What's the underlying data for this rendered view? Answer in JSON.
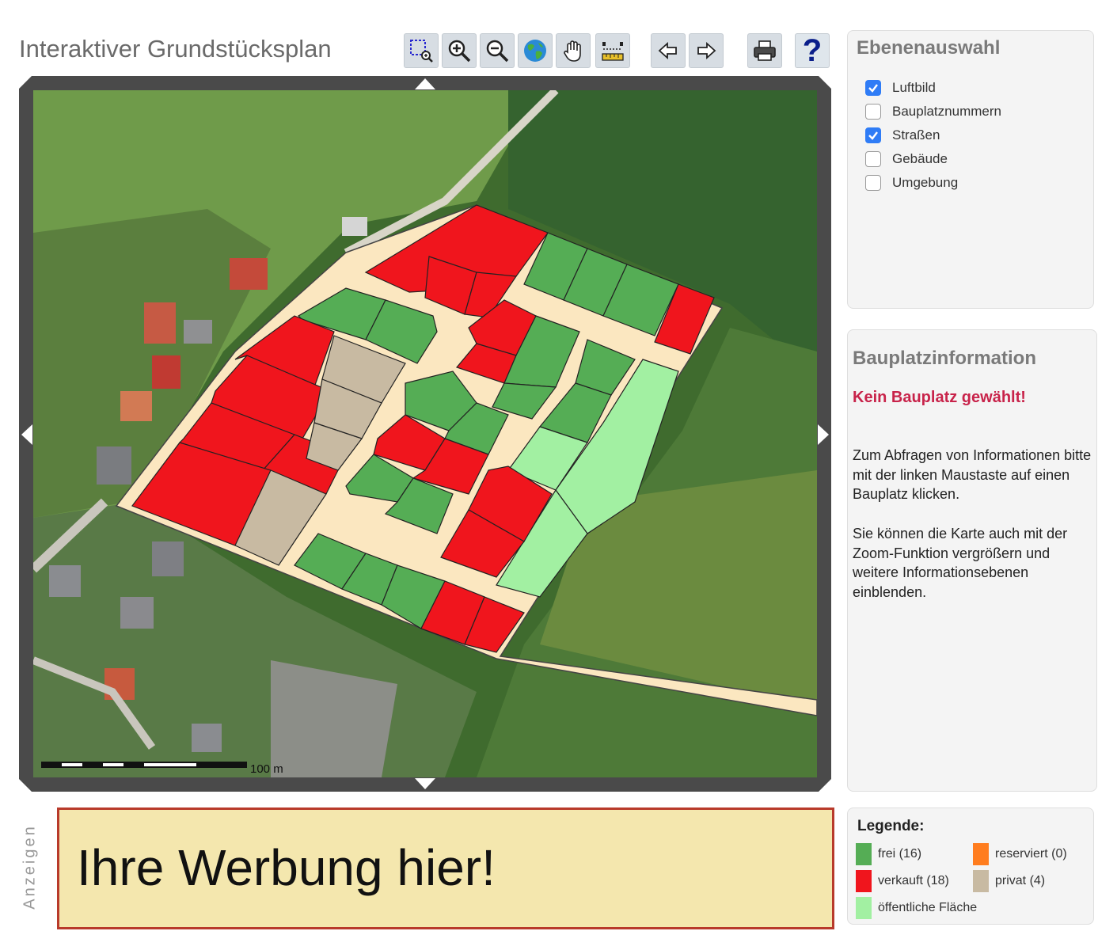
{
  "header": {
    "title": "Interaktiver Grundstücksplan"
  },
  "toolbar": {
    "tools": [
      {
        "name": "zoom-box-icon"
      },
      {
        "name": "zoom-in-icon"
      },
      {
        "name": "zoom-out-icon"
      },
      {
        "name": "globe-icon"
      },
      {
        "name": "pan-hand-icon"
      },
      {
        "name": "measure-ruler-icon"
      },
      {
        "name": "back-arrow-icon"
      },
      {
        "name": "forward-arrow-icon"
      },
      {
        "name": "print-icon"
      },
      {
        "name": "help-icon"
      }
    ],
    "help_label": "?"
  },
  "map": {
    "scale_label": "100 m",
    "colors": {
      "frei": "#55ad55",
      "verkauft": "#f0151d",
      "privat": "#c8baa2",
      "oeffentlich": "#a2f0a2",
      "strasse": "#fbe7c0"
    }
  },
  "layers": {
    "title": "Ebenenauswahl",
    "items": [
      {
        "label": "Luftbild",
        "checked": true
      },
      {
        "label": "Bauplatznummern",
        "checked": false
      },
      {
        "label": "Straßen",
        "checked": true
      },
      {
        "label": "Gebäude",
        "checked": false
      },
      {
        "label": "Umgebung",
        "checked": false
      }
    ]
  },
  "info": {
    "title": "Bauplatzinformation",
    "status": "Kein Bauplatz gewählt!",
    "status_color": "#c8234a",
    "paragraph1": "Zum Abfragen von Informationen bitte mit der linken Maustaste auf einen Bauplatz klicken.",
    "paragraph2": "Sie können die Karte auch mit der Zoom-Funktion vergrößern und weitere Informationsebenen einblenden."
  },
  "ads": {
    "label": "Anzeigen",
    "text": "Ihre Werbung hier!"
  },
  "legend": {
    "title": "Legende:",
    "items": [
      {
        "label": "frei (16)",
        "color": "#55ad55"
      },
      {
        "label": "reserviert (0)",
        "color": "#ff7d1f"
      },
      {
        "label": "verkauft (18)",
        "color": "#f0151d"
      },
      {
        "label": "privat (4)",
        "color": "#c8baa2"
      },
      {
        "label": "öffentliche Fläche",
        "color": "#a2f0a2"
      }
    ]
  }
}
